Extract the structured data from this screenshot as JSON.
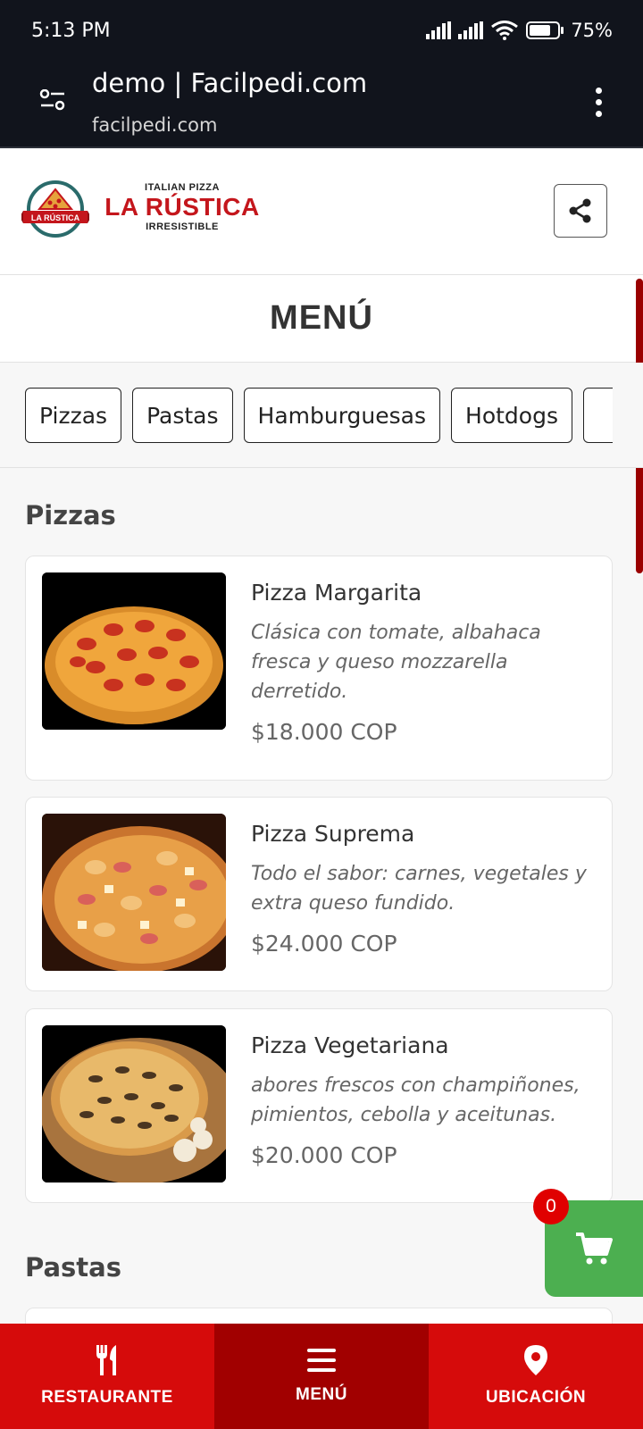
{
  "status_bar": {
    "time": "5:13 PM",
    "battery": "75%"
  },
  "browser": {
    "title": "demo | Facilpedi.com",
    "url": "facilpedi.com"
  },
  "brand": {
    "badge_text": "LA RÚSTICA",
    "top_line": "ITALIAN PIZZA",
    "name": "LA RÚSTICA",
    "tagline": "IRRESISTIBLE"
  },
  "page": {
    "title": "MENÚ"
  },
  "categories": [
    "Pizzas",
    "Pastas",
    "Hamburguesas",
    "Hotdogs"
  ],
  "sections": [
    {
      "title": "Pizzas",
      "items": [
        {
          "name": "Pizza Margarita",
          "description": "Clásica con tomate, albahaca fresca y queso mozzarella derretido.",
          "price": "$18.000 COP",
          "image": "pepperoni-pizza-image"
        },
        {
          "name": "Pizza Suprema",
          "description": "Todo el sabor: carnes, vegetales y extra queso fundido.",
          "price": "$24.000 COP",
          "image": "hawaiian-pizza-image"
        },
        {
          "name": "Pizza Vegetariana",
          "description": "abores frescos con champiñones, pimientos, cebolla y aceitunas.",
          "price": "$20.000 COP",
          "image": "mushroom-pizza-image"
        }
      ]
    },
    {
      "title": "Pastas",
      "items": []
    }
  ],
  "cart": {
    "count": "0",
    "icon": "cart-icon"
  },
  "bottom_nav": [
    {
      "label": "RESTAURANTE",
      "icon": "fork-knife-icon"
    },
    {
      "label": "MENÚ",
      "icon": "menu-icon",
      "active": true
    },
    {
      "label": "UBICACIÓN",
      "icon": "location-pin-icon"
    }
  ],
  "colors": {
    "brand_red": "#d60b0b",
    "active_red": "#a10000",
    "cart_green": "#4caf50",
    "badge_red": "#e00000",
    "status_bg": "#11141c"
  }
}
